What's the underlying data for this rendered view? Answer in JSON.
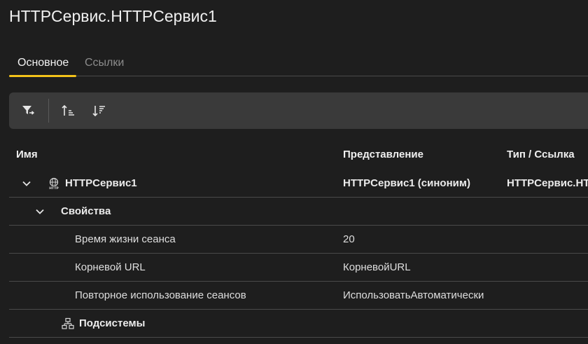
{
  "window": {
    "title": "HTTPСервис.HTTPСервис1"
  },
  "tabs": [
    {
      "label": "Основное",
      "active": true
    },
    {
      "label": "Ссылки",
      "active": false
    }
  ],
  "toolbar": {
    "buttons": [
      {
        "name": "filter",
        "icon": "filter-arrow-icon"
      },
      {
        "name": "sort-ascending",
        "icon": "sort-ascending-icon"
      },
      {
        "name": "sort-descending",
        "icon": "sort-descending-icon"
      }
    ]
  },
  "table": {
    "columns": [
      "Имя",
      "Представление",
      "Тип / Ссылка"
    ],
    "rows": [
      {
        "name": "HTTPСервис1",
        "presentation": "HTTPСервис1 (синоним)",
        "type": "HTTPСервис.HT",
        "expanded": true,
        "icon": "http-globe-icon"
      },
      {
        "name": "Свойства",
        "presentation": "",
        "type": "",
        "expanded": true
      },
      {
        "name": "Время жизни сеанса",
        "presentation": "20",
        "type": ""
      },
      {
        "name": "Корневой URL",
        "presentation": "КорневойURL",
        "type": ""
      },
      {
        "name": "Повторное использование сеансов",
        "presentation": "ИспользоватьАвтоматически",
        "type": ""
      },
      {
        "name": "Подсистемы",
        "presentation": "",
        "type": "",
        "icon": "subsystems-hierarchy-icon"
      }
    ]
  },
  "colors": {
    "background": "#1e1e1e",
    "toolbar": "#3a3a3a",
    "accent": "#f3c21a",
    "divider": "#4a4a4a"
  }
}
